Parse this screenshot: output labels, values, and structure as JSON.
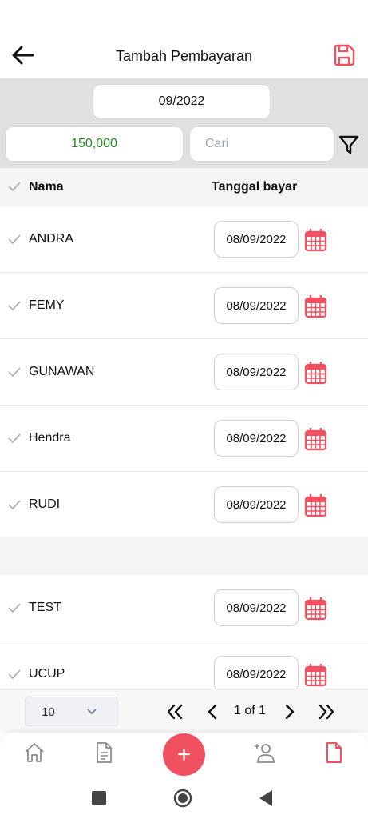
{
  "header": {
    "title": "Tambah Pembayaran",
    "back_icon": "arrow-left-icon",
    "save_icon": "floppy-save-icon"
  },
  "colors": {
    "accent": "#f0505f",
    "amount_green": "#1f8a1f",
    "panel_gray": "#e0e0e0"
  },
  "filters": {
    "month": "09/2022",
    "amount": "150,000",
    "search_placeholder": "Cari",
    "filter_icon": "funnel-icon"
  },
  "table": {
    "headers": {
      "name": "Nama",
      "date": "Tanggal bayar"
    },
    "rows": [
      {
        "name": "ANDRA",
        "date": "08/09/2022"
      },
      {
        "name": "FEMY",
        "date": "08/09/2022"
      },
      {
        "name": "GUNAWAN",
        "date": "08/09/2022"
      },
      {
        "name": "Hendra",
        "date": "08/09/2022"
      },
      {
        "name": "RUDI",
        "date": "08/09/2022"
      },
      {
        "name": "TEST",
        "date": "08/09/2022"
      },
      {
        "name": "UCUP",
        "date": "08/09/2022"
      }
    ]
  },
  "pager": {
    "page_size": "10",
    "page_label": "1 of 1"
  },
  "bottom_nav": {
    "items": [
      "home-icon",
      "document-list-icon",
      "add-icon",
      "add-user-icon",
      "document-icon"
    ],
    "fab_label": "+"
  }
}
